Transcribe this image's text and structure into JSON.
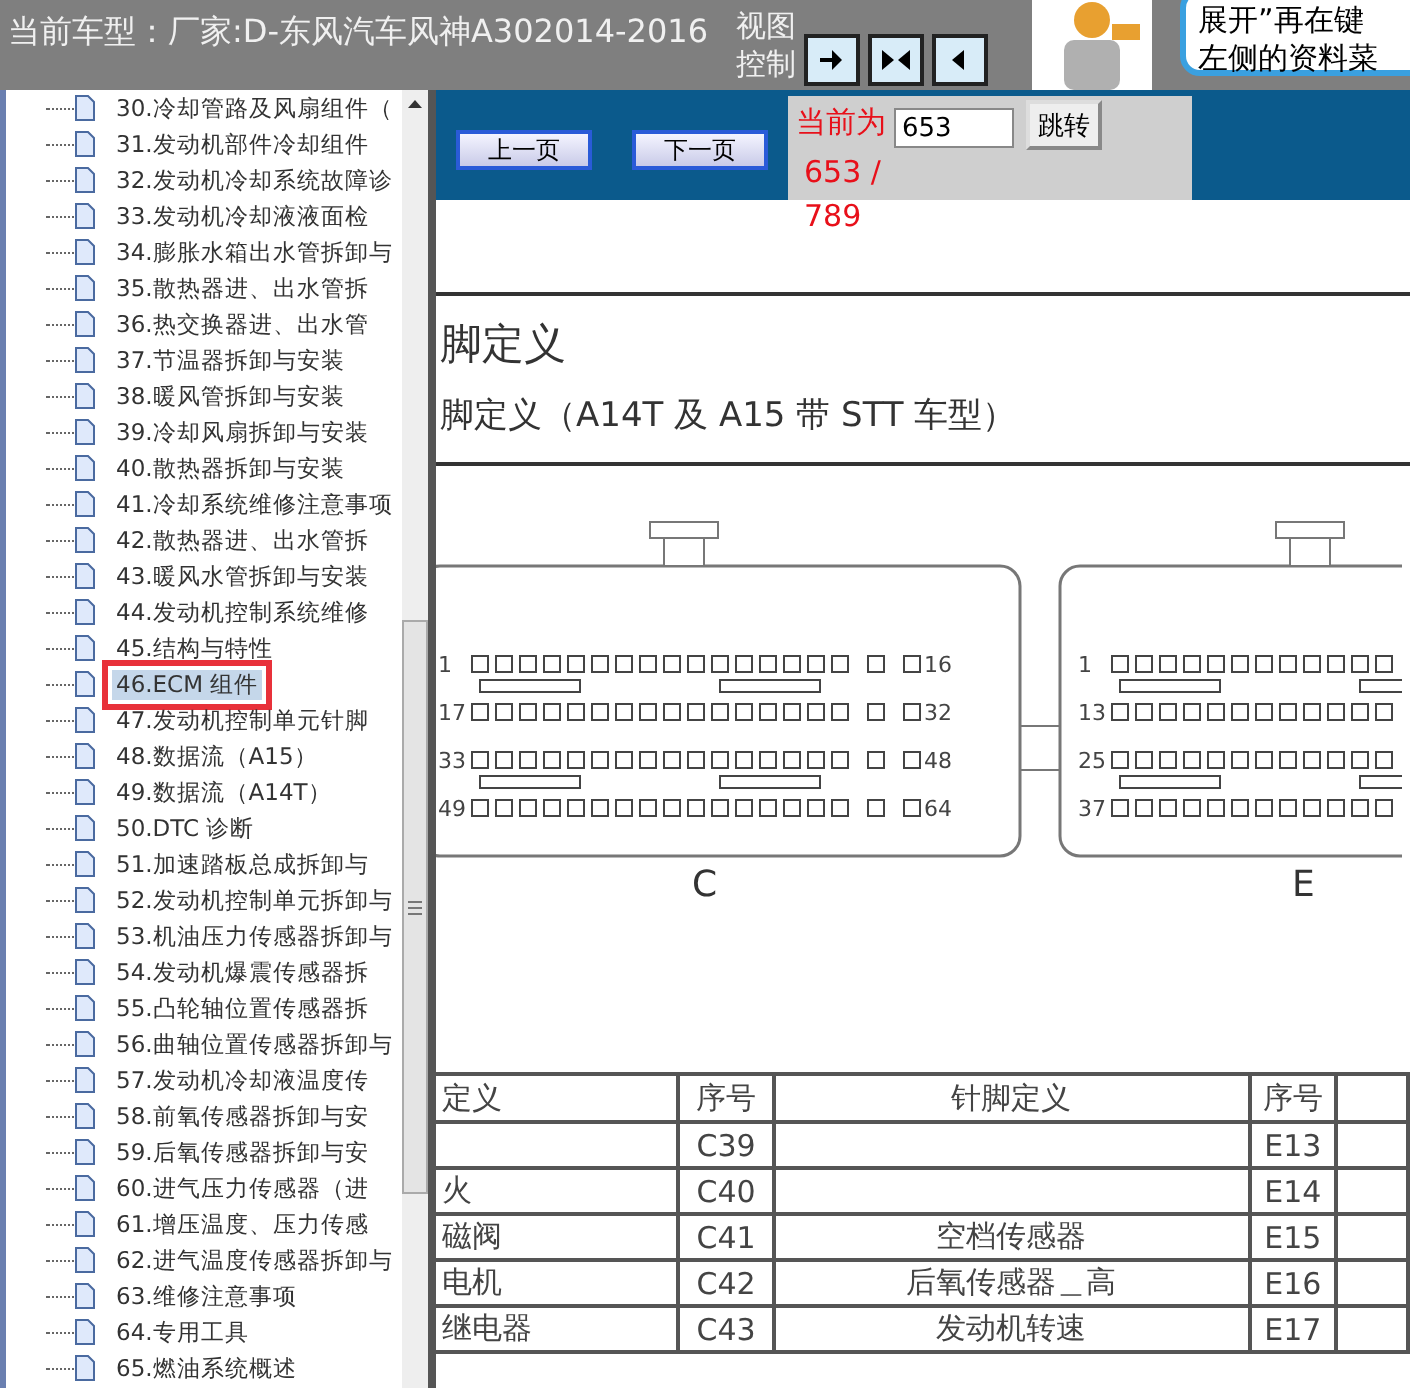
{
  "header": {
    "title": "当前车型：厂家:D-东风汽车风神A302014-2016",
    "view_label": [
      "视图",
      "控制"
    ],
    "bubble_lines": [
      "展开”再在键",
      "左侧的资料菜"
    ]
  },
  "tree": {
    "items": [
      {
        "label": "30.冷却管路及风扇组件（",
        "selected": false
      },
      {
        "label": "31.发动机部件冷却组件",
        "selected": false
      },
      {
        "label": "32.发动机冷却系统故障诊",
        "selected": false
      },
      {
        "label": "33.发动机冷却液液面检",
        "selected": false
      },
      {
        "label": "34.膨胀水箱出水管拆卸与",
        "selected": false
      },
      {
        "label": "35.散热器进、出水管拆",
        "selected": false
      },
      {
        "label": "36.热交换器进、出水管",
        "selected": false
      },
      {
        "label": "37.节温器拆卸与安装",
        "selected": false
      },
      {
        "label": "38.暖风管拆卸与安装",
        "selected": false
      },
      {
        "label": "39.冷却风扇拆卸与安装",
        "selected": false
      },
      {
        "label": "40.散热器拆卸与安装",
        "selected": false
      },
      {
        "label": "41.冷却系统维修注意事项",
        "selected": false
      },
      {
        "label": "42.散热器进、出水管拆",
        "selected": false
      },
      {
        "label": "43.暖风水管拆卸与安装",
        "selected": false
      },
      {
        "label": "44.发动机控制系统维修",
        "selected": false
      },
      {
        "label": "45.结构与特性",
        "selected": false
      },
      {
        "label": "46.ECM 组件",
        "selected": true
      },
      {
        "label": "47.发动机控制单元针脚",
        "selected": false
      },
      {
        "label": "48.数据流（A15）",
        "selected": false
      },
      {
        "label": "49.数据流（A14T）",
        "selected": false
      },
      {
        "label": "50.DTC 诊断",
        "selected": false
      },
      {
        "label": "51.加速踏板总成拆卸与",
        "selected": false
      },
      {
        "label": "52.发动机控制单元拆卸与",
        "selected": false
      },
      {
        "label": "53.机油压力传感器拆卸与",
        "selected": false
      },
      {
        "label": "54.发动机爆震传感器拆",
        "selected": false
      },
      {
        "label": "55.凸轮轴位置传感器拆",
        "selected": false
      },
      {
        "label": "56.曲轴位置传感器拆卸与",
        "selected": false
      },
      {
        "label": "57.发动机冷却液温度传",
        "selected": false
      },
      {
        "label": "58.前氧传感器拆卸与安",
        "selected": false
      },
      {
        "label": "59.后氧传感器拆卸与安",
        "selected": false
      },
      {
        "label": "60.进气压力传感器（进",
        "selected": false
      },
      {
        "label": "61.增压温度、压力传感",
        "selected": false
      },
      {
        "label": "62.进气温度传感器拆卸与",
        "selected": false
      },
      {
        "label": "63.维修注意事项",
        "selected": false
      },
      {
        "label": "64.专用工具",
        "selected": false
      },
      {
        "label": "65.燃油系统概述",
        "selected": false
      }
    ]
  },
  "nav": {
    "prev": "上一页",
    "next": "下一页",
    "current_label": "当前为",
    "page_value": "653",
    "jump": "跳转",
    "page_count": "653 / 789"
  },
  "document": {
    "title": "脚定义",
    "subtitle": "脚定义（A14T 及 A15 带 STT 车型）",
    "connectors": [
      {
        "letter": "C",
        "pins": [
          "1",
          "16",
          "17",
          "32",
          "33",
          "48",
          "49",
          "64"
        ]
      },
      {
        "letter": "E",
        "pins": [
          "1",
          "13",
          "25",
          "37"
        ]
      }
    ],
    "table": {
      "columns": [
        "定义",
        "序号",
        "针脚定义",
        "序号"
      ],
      "rows": [
        [
          "",
          "C39",
          "",
          "E13"
        ],
        [
          "火",
          "C40",
          "",
          "E14"
        ],
        [
          "磁阀",
          "C41",
          "空档传感器",
          "E15"
        ],
        [
          "电机",
          "C42",
          "后氧传感器＿高",
          "E16"
        ],
        [
          "继电器",
          "C43",
          "发动机转速",
          "E17"
        ]
      ]
    }
  }
}
